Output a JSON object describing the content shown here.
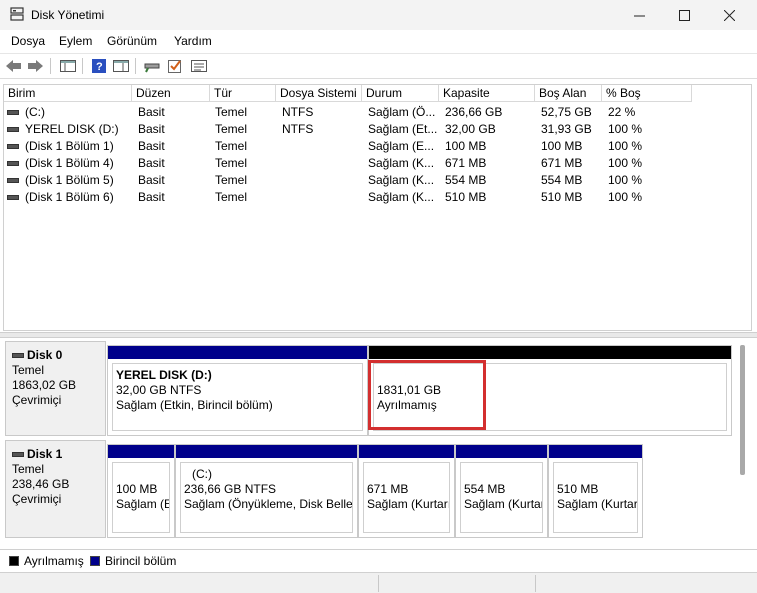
{
  "window": {
    "title": "Disk Yönetimi"
  },
  "menu": [
    "Dosya",
    "Eylem",
    "Görünüm",
    "Yardım"
  ],
  "volume_list": {
    "columns": [
      "Birim",
      "Düzen",
      "Tür",
      "Dosya Sistemi",
      "Durum",
      "Kapasite",
      "Boş Alan",
      "% Boş"
    ],
    "rows": [
      [
        "(C:)",
        "Basit",
        "Temel",
        "NTFS",
        "Sağlam (Ö...",
        "236,66 GB",
        "52,75 GB",
        "22 %"
      ],
      [
        "YEREL DISK (D:)",
        "Basit",
        "Temel",
        "NTFS",
        "Sağlam (Et...",
        "32,00 GB",
        "31,93 GB",
        "100 %"
      ],
      [
        "(Disk 1 Bölüm 1)",
        "Basit",
        "Temel",
        "",
        "Sağlam (E...",
        "100 MB",
        "100 MB",
        "100 %"
      ],
      [
        "(Disk 1 Bölüm 4)",
        "Basit",
        "Temel",
        "",
        "Sağlam (K...",
        "671 MB",
        "671 MB",
        "100 %"
      ],
      [
        "(Disk 1 Bölüm 5)",
        "Basit",
        "Temel",
        "",
        "Sağlam (K...",
        "554 MB",
        "554 MB",
        "100 %"
      ],
      [
        "(Disk 1 Bölüm 6)",
        "Basit",
        "Temel",
        "",
        "Sağlam (K...",
        "510 MB",
        "510 MB",
        "100 %"
      ]
    ]
  },
  "disks": [
    {
      "name": "Disk 0",
      "type": "Temel",
      "size": "1863,02 GB",
      "status": "Çevrimiçi",
      "partitions": [
        {
          "title": "YEREL DISK  (D:)",
          "line1": "32,00 GB NTFS",
          "line2": "Sağlam (Etkin, Birincil bölüm)"
        },
        {
          "title": "",
          "line1": "1831,01 GB",
          "line2": "Ayrılmamış"
        }
      ]
    },
    {
      "name": "Disk 1",
      "type": "Temel",
      "size": "238,46 GB",
      "status": "Çevrimiçi",
      "partitions": [
        {
          "title": "",
          "line1": "100 MB",
          "line2": "Sağlam (E"
        },
        {
          "title": "(C:)",
          "line1": "236,66 GB NTFS",
          "line2": "Sağlam (Önyükleme, Disk Belleğ"
        },
        {
          "title": "",
          "line1": "671 MB",
          "line2": "Sağlam (Kurtarı"
        },
        {
          "title": "",
          "line1": "554 MB",
          "line2": "Sağlam (Kurtar"
        },
        {
          "title": "",
          "line1": "510 MB",
          "line2": "Sağlam (Kurtar"
        }
      ]
    }
  ],
  "legend": {
    "unallocated": "Ayrılmamış",
    "primary": "Birincil bölüm"
  },
  "colors": {
    "primary": "#00008b",
    "unallocated": "#000000",
    "highlight": "#d32f2f"
  }
}
